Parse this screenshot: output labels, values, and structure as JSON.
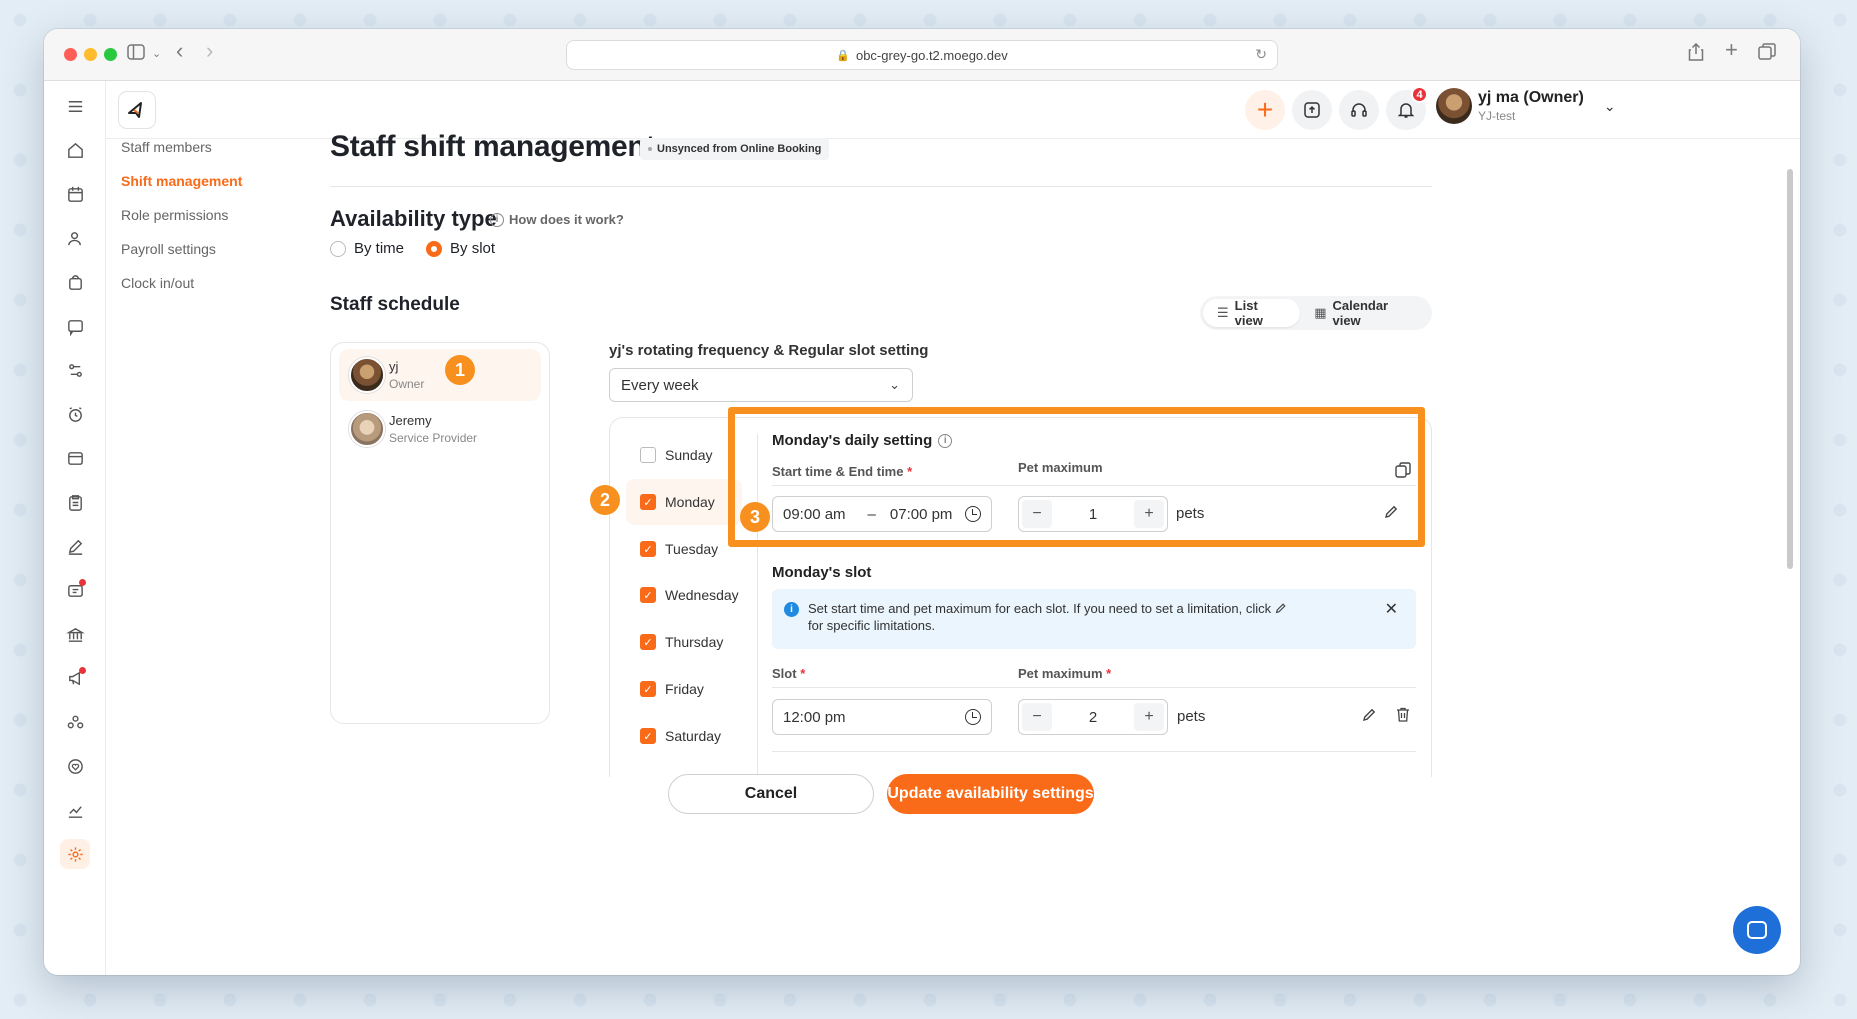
{
  "browser": {
    "url": "obc-grey-go.t2.moego.dev"
  },
  "header": {
    "notification_count": "4",
    "user_name": "yj ma (Owner)",
    "business": "YJ-test"
  },
  "subnav": {
    "items": [
      "Staff members",
      "Shift management",
      "Role permissions",
      "Payroll settings",
      "Clock in/out"
    ],
    "active": "Shift management"
  },
  "page": {
    "title": "Staff shift management",
    "sync_badge": "Unsynced from Online Booking",
    "availability_title": "Availability type",
    "how_link": "How does it work?",
    "radio_by_time": "By time",
    "radio_by_slot": "By slot",
    "selected_type": "By slot",
    "schedule_title": "Staff schedule",
    "list_view": "List view",
    "calendar_view": "Calendar view"
  },
  "staff": [
    {
      "name": "yj",
      "role": "Owner",
      "selected": true
    },
    {
      "name": "Jeremy",
      "role": "Service Provider",
      "selected": false
    }
  ],
  "rotation": {
    "title": "yj's rotating frequency & Regular slot setting",
    "frequency": "Every week"
  },
  "days": [
    {
      "label": "Sunday",
      "checked": false
    },
    {
      "label": "Monday",
      "checked": true
    },
    {
      "label": "Tuesday",
      "checked": true
    },
    {
      "label": "Wednesday",
      "checked": true
    },
    {
      "label": "Thursday",
      "checked": true
    },
    {
      "label": "Friday",
      "checked": true
    },
    {
      "label": "Saturday",
      "checked": true
    }
  ],
  "daily": {
    "title": "Monday's daily setting",
    "time_label": "Start time & End time",
    "pet_label": "Pet maximum",
    "start": "09:00 am",
    "dash": "–",
    "end": "07:00 pm",
    "pet_max": "1",
    "pets_unit": "pets"
  },
  "slot": {
    "title": "Monday's slot",
    "info_line1": "Set start time and pet maximum for each slot. If you need to set a limitation, click",
    "info_line2": "for specific limitations.",
    "slot_label": "Slot",
    "pet_label": "Pet maximum",
    "time": "12:00 pm",
    "pet_max": "2",
    "pets_unit": "pets"
  },
  "callouts": [
    "1",
    "2",
    "3"
  ],
  "footer": {
    "cancel": "Cancel",
    "update": "Update availability settings"
  },
  "colors": {
    "accent": "#f96b18",
    "callout": "#f7901e",
    "chat": "#1f6fd8"
  }
}
